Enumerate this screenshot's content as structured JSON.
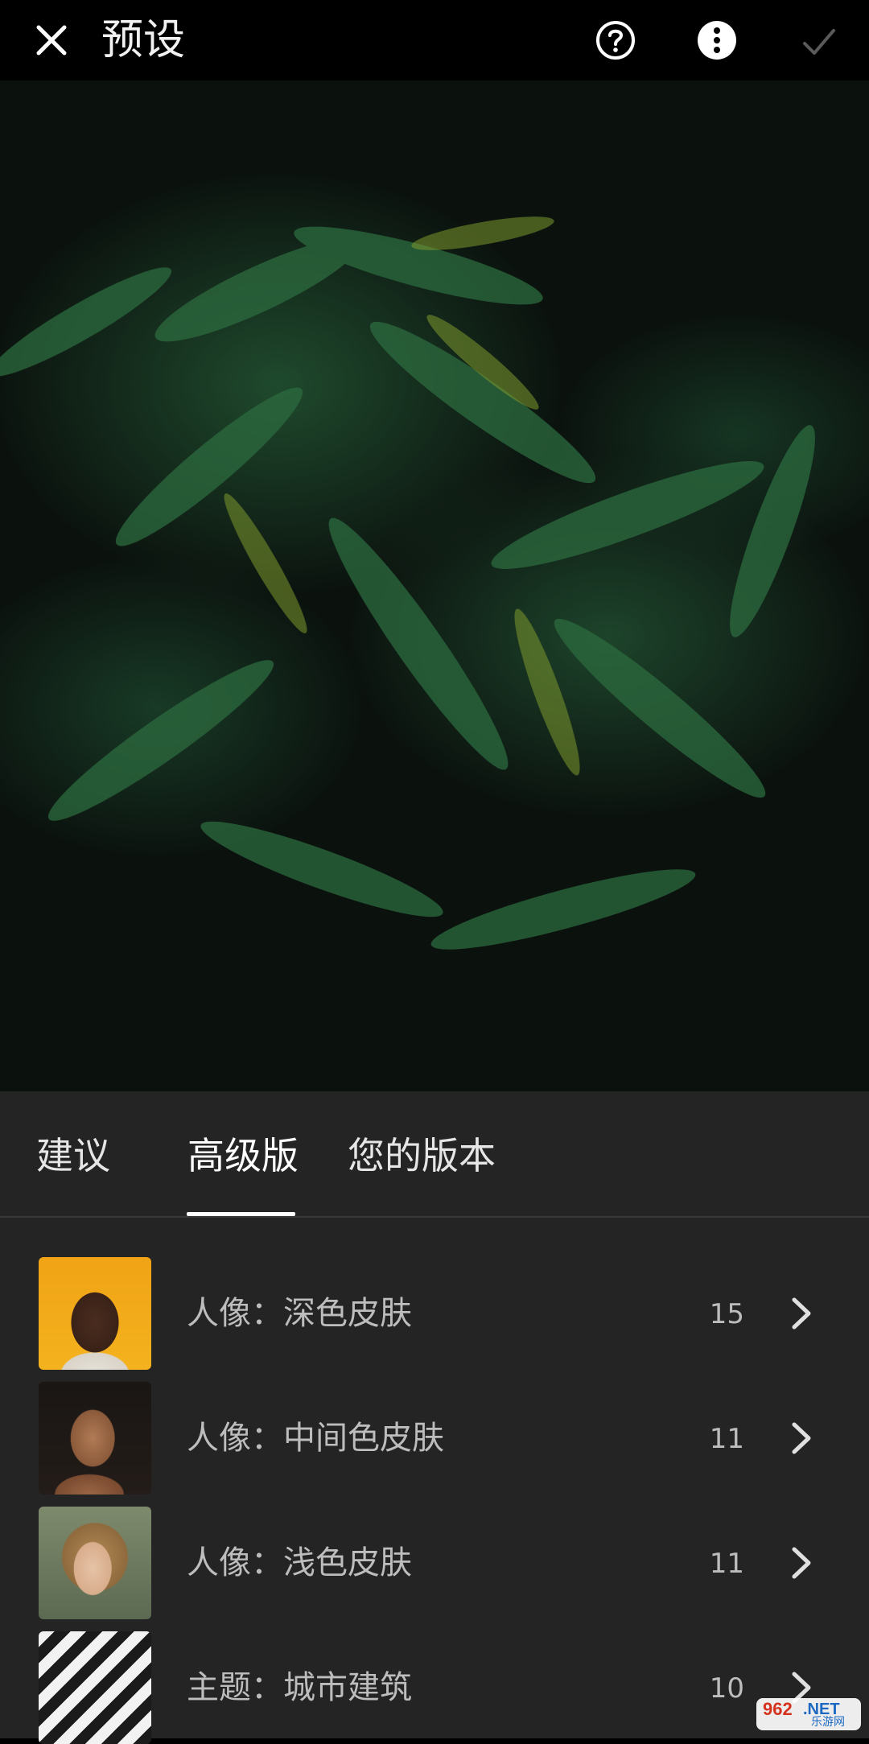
{
  "header": {
    "title": "预设",
    "close_icon": "close-icon",
    "help_icon": "help-circle-icon",
    "more_icon": "more-vertical-icon",
    "confirm_icon": "check-icon"
  },
  "tabs": [
    {
      "label": "建议",
      "active": false
    },
    {
      "label": "高级版",
      "active": true
    },
    {
      "label": "您的版本",
      "active": false
    }
  ],
  "preset_groups": [
    {
      "label": "人像：深色皮肤",
      "count": "15"
    },
    {
      "label": "人像：中间色皮肤",
      "count": "11"
    },
    {
      "label": "人像：浅色皮肤",
      "count": "11"
    },
    {
      "label": "主题：城市建筑",
      "count": "10"
    }
  ],
  "watermark": {
    "brand": "962",
    "suffix": ".NET",
    "sub": "乐游网"
  },
  "colors": {
    "panel_bg": "#242424",
    "topbar_bg": "#000000",
    "accent": "#ffffff"
  }
}
